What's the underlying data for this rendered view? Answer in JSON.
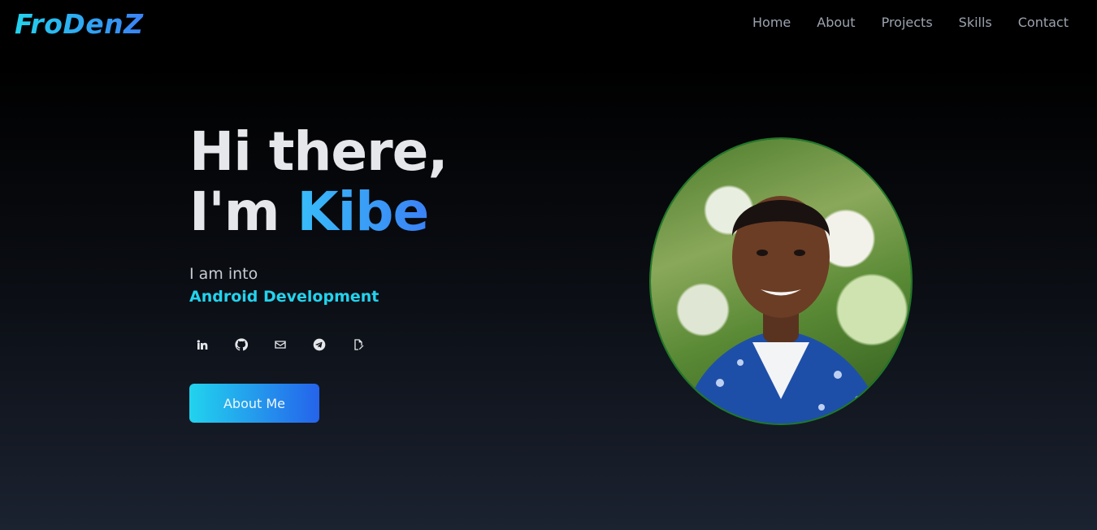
{
  "brand": {
    "logo_text": "FroDenZ"
  },
  "nav": {
    "items": [
      {
        "label": "Home"
      },
      {
        "label": "About"
      },
      {
        "label": "Projects"
      },
      {
        "label": "Skills"
      },
      {
        "label": "Contact"
      }
    ]
  },
  "hero": {
    "greeting_line1": "Hi there,",
    "greeting_prefix": "I'm",
    "name": "Kibe",
    "intro": "I am into",
    "focus": "Android Development",
    "cta_label": "About Me"
  },
  "socials": [
    {
      "icon": "linkedin-icon"
    },
    {
      "icon": "github-icon"
    },
    {
      "icon": "mail-icon"
    },
    {
      "icon": "telegram-icon"
    },
    {
      "icon": "edit-document-icon"
    }
  ],
  "colors": {
    "accent_start": "#22d3ee",
    "accent_end": "#3b82f6",
    "background_top": "#000000",
    "background_bottom": "#1b2230"
  }
}
